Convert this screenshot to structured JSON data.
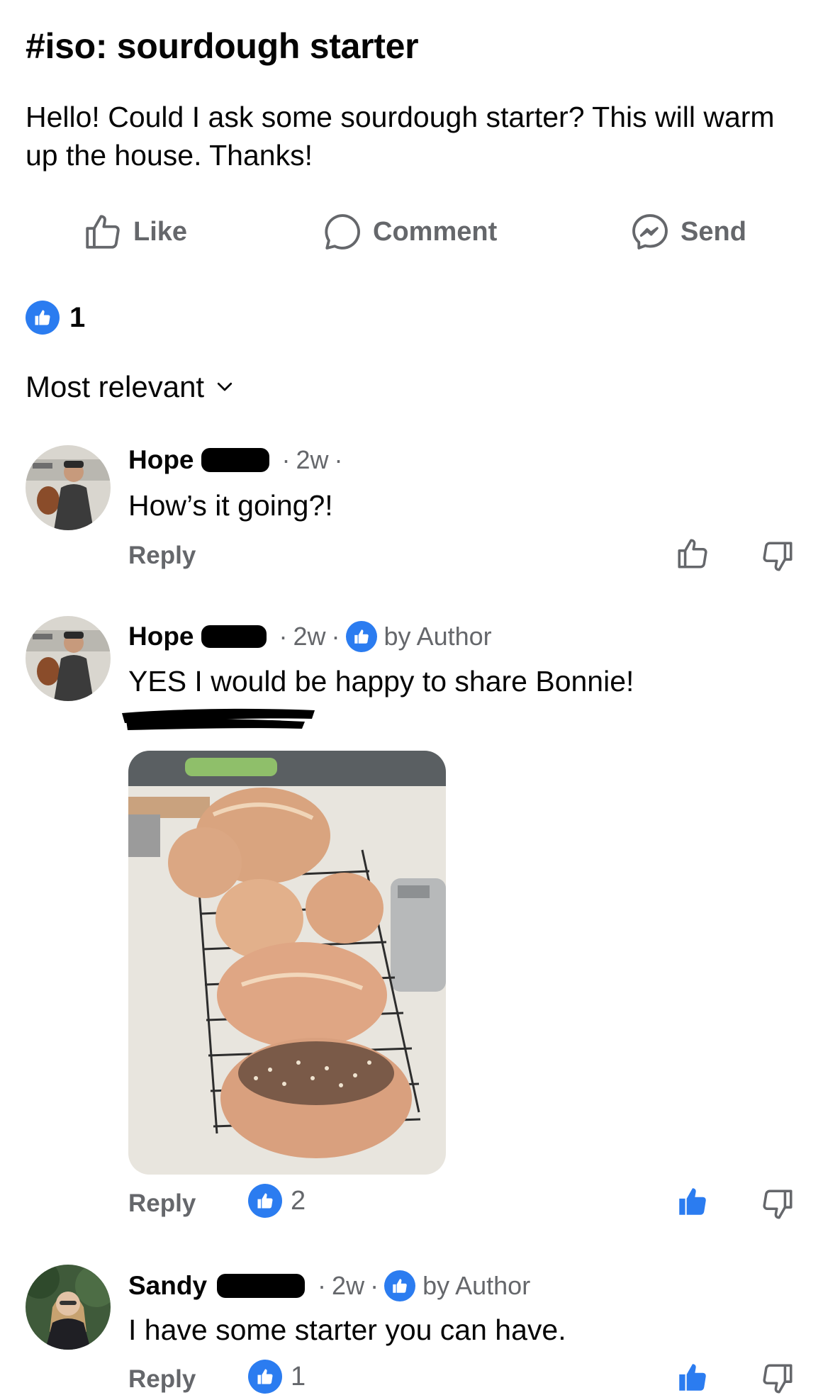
{
  "post": {
    "title": "#iso: sourdough starter",
    "body": "Hello! Could I ask some sourdough starter? This will warm up the house. Thanks!"
  },
  "actions": {
    "like": "Like",
    "comment": "Comment",
    "send": "Send"
  },
  "reactions": {
    "count": "1"
  },
  "sort": {
    "label": "Most relevant"
  },
  "comments": [
    {
      "author": "Hope",
      "time": "2w",
      "badge": "",
      "text": "How’s it going?!",
      "reply": "Reply",
      "like_count": "",
      "liked": false
    },
    {
      "author": "Hope",
      "time": "2w",
      "badge": "by Author",
      "text": "YES I would be happy to share Bonnie!",
      "reply": "Reply",
      "like_count": "2",
      "liked": true
    },
    {
      "author": "Sandy",
      "time": "2w",
      "badge": "by Author",
      "text": "I have some starter you can have.",
      "reply": "Reply",
      "like_count": "1",
      "liked": true
    }
  ],
  "colors": {
    "accent": "#2b7cf0",
    "muted": "#65676b",
    "text": "#050505"
  },
  "icons": [
    "thumbs-up-icon",
    "comment-bubble-icon",
    "messenger-icon",
    "chevron-down-icon",
    "thumbs-down-icon"
  ]
}
